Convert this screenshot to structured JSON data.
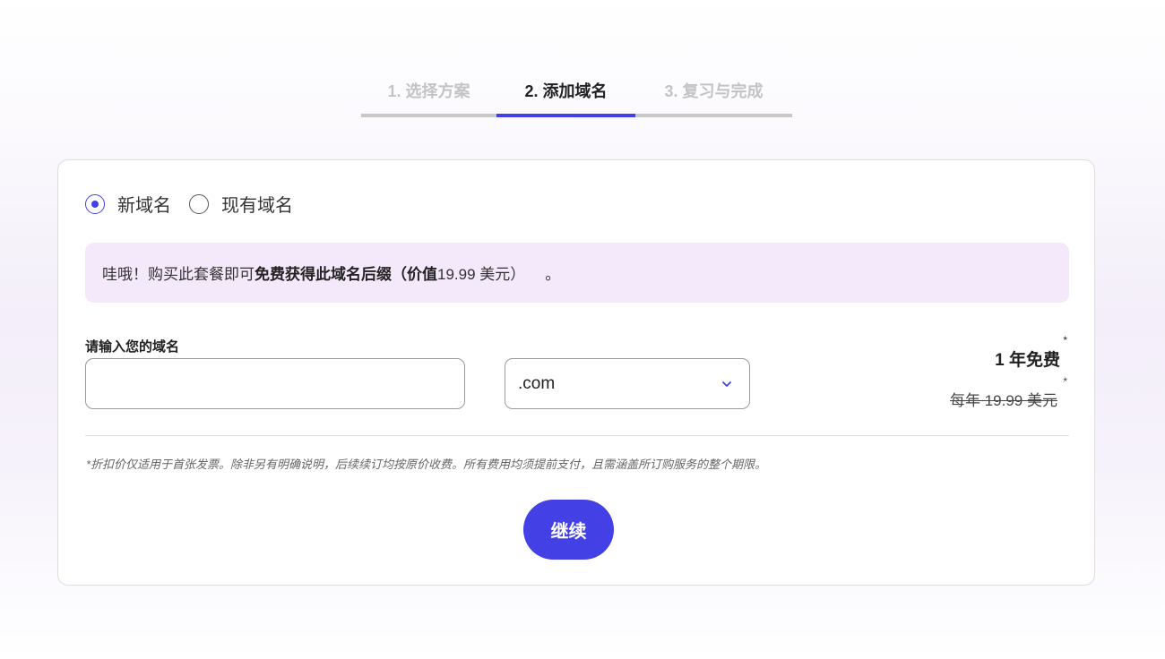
{
  "stepper": {
    "steps": [
      {
        "label": "1. 选择方案",
        "state": "inactive"
      },
      {
        "label": "2. 添加域名",
        "state": "active"
      },
      {
        "label": "3. 复习与完成",
        "state": "inactive"
      }
    ]
  },
  "domain_type": {
    "options": [
      {
        "label": "新域名",
        "checked": true
      },
      {
        "label": "现有域名",
        "checked": false
      }
    ]
  },
  "promo": {
    "prefix": "哇哦！购买此套餐即可",
    "bold": "免费获得此域名后缀（价值",
    "value": "19.99 美元）",
    "suffix": "。"
  },
  "domain_form": {
    "label": "请输入您的域名",
    "input_value": "",
    "input_placeholder": "",
    "tld_selected": ".com"
  },
  "pricing": {
    "free_label": "1 年免费",
    "regular_price": "每年 19.99 美元",
    "asterisk": "*"
  },
  "disclaimer": "*折扣价仅适用于首张发票。除非另有明确说明，后续续订均按原价收费。所有费用均须提前支付，且需涵盖所订购服务的整个期限。",
  "continue_label": "继续",
  "colors": {
    "accent": "#4340e6",
    "promo_bg": "#f3e9fa",
    "inactive_step": "#c3c3c3"
  },
  "icons": {
    "dropdown": "chevron-down-icon"
  }
}
